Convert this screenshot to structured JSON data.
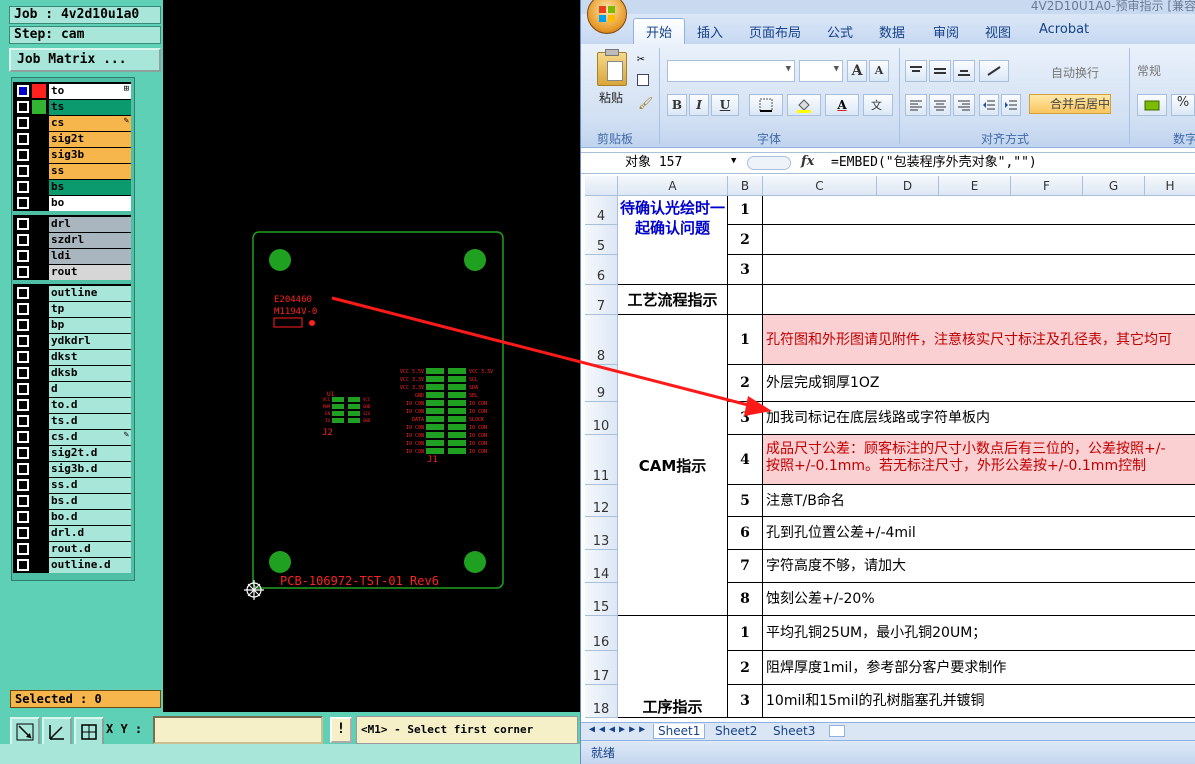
{
  "cam": {
    "job_label": "Job : 4v2d10u1a0",
    "step_label": "Step: cam",
    "job_matrix_button": "Job Matrix ...",
    "layers": [
      {
        "name": "to",
        "color": "#ffffff",
        "swatch": "#ff2020",
        "selected": true,
        "mark": "⊞"
      },
      {
        "name": "ts",
        "color": "#0a9a6e",
        "swatch": "#32b432",
        "selected": false,
        "mark": ""
      },
      {
        "name": "cs",
        "color": "#f6b64b",
        "swatch": "",
        "selected": false,
        "mark": "✎"
      },
      {
        "name": "sig2t",
        "color": "#f6b64b",
        "swatch": "",
        "selected": false,
        "mark": ""
      },
      {
        "name": "sig3b",
        "color": "#f6b64b",
        "swatch": "",
        "selected": false,
        "mark": ""
      },
      {
        "name": "ss",
        "color": "#f6b64b",
        "swatch": "",
        "selected": false,
        "mark": ""
      },
      {
        "name": "bs",
        "color": "#0a9a6e",
        "swatch": "",
        "selected": false,
        "mark": ""
      },
      {
        "name": "bo",
        "color": "#ffffff",
        "swatch": "",
        "selected": false,
        "mark": ""
      }
    ],
    "drill_layers": [
      {
        "name": "drl",
        "color": "#a9b6bf"
      },
      {
        "name": "szdrl",
        "color": "#a9b6bf"
      },
      {
        "name": "ldi",
        "color": "#a9b6bf"
      },
      {
        "name": "rout",
        "color": "#d6d6d6"
      }
    ],
    "misc_layers": [
      {
        "name": "outline",
        "mark": ""
      },
      {
        "name": "tp",
        "mark": ""
      },
      {
        "name": "bp",
        "mark": ""
      },
      {
        "name": "ydkdrl",
        "mark": ""
      },
      {
        "name": "dkst",
        "mark": ""
      },
      {
        "name": "dksb",
        "mark": ""
      },
      {
        "name": "d",
        "mark": ""
      },
      {
        "name": "to.d",
        "mark": ""
      },
      {
        "name": "ts.d",
        "mark": ""
      },
      {
        "name": "cs.d",
        "mark": "✎"
      },
      {
        "name": "sig2t.d",
        "mark": ""
      },
      {
        "name": "sig3b.d",
        "mark": ""
      },
      {
        "name": "ss.d",
        "mark": ""
      },
      {
        "name": "bs.d",
        "mark": ""
      },
      {
        "name": "bo.d",
        "mark": ""
      },
      {
        "name": "drl.d",
        "mark": ""
      },
      {
        "name": "rout.d",
        "mark": ""
      },
      {
        "name": "outline.d",
        "mark": ""
      }
    ],
    "misc_color": "#a9e6da",
    "selected_label": "Selected : 0",
    "xy_label": "X Y :",
    "xy_value": "",
    "bang_label": "!",
    "status_message": "<M1> - Select first corner",
    "board": {
      "part_code": "E204460",
      "ul_mark": "M1194V-0",
      "footer_text": "PCB-106972-TST-01   Rev6",
      "j1_label": "J1",
      "j2_label": "J2",
      "u1_label": "U1",
      "j1_left_pins": [
        "VCC 5.5V",
        "VCC 3.3V",
        "VCC 3.3V",
        "GND",
        "IO CON",
        "IO CON",
        "DATA",
        "IO CON",
        "IO CON",
        "IO CON",
        "IO CON"
      ],
      "j1_right_pins": [
        "VCC 3.3V",
        "SCL",
        "SDA",
        "SEL",
        "IO CON",
        "IO CON",
        "SLOCK",
        "IO CON",
        "IO CON",
        "IO CON",
        "IO CON"
      ],
      "j2_left_pins": [
        "VCC",
        "PWM",
        "EN",
        "IO"
      ],
      "j2_right_pins": [
        "VCC",
        "GND",
        "SIG",
        "GND"
      ]
    }
  },
  "excel": {
    "title": "4V2D10U1A0-预审指示 [兼容",
    "tabs": [
      "开始",
      "插入",
      "页面布局",
      "公式",
      "数据",
      "审阅",
      "视图",
      "Acrobat"
    ],
    "active_tab": "开始",
    "ribbon": {
      "paste_label": "粘贴",
      "clipboard_group": "剪贴板",
      "font_group": "字体",
      "align_group": "对齐方式",
      "number_group": "数字",
      "wrap_text": "自动换行",
      "merge_center": "合并后居中",
      "number_format": "常规",
      "bold": "B",
      "italic": "I",
      "underline": "U",
      "grow_font": "A",
      "shrink_font": "A",
      "font_color": "A",
      "percent": "%"
    },
    "name_box": "对象 157",
    "fx": "fx",
    "formula": "=EMBED(\"包装程序外壳对象\",\"\")",
    "columns": [
      "A",
      "B",
      "C",
      "D",
      "E",
      "F",
      "G",
      "H"
    ],
    "rows": [
      {
        "num": "4",
        "b": "1",
        "c": "",
        "pink": false
      },
      {
        "num": "5",
        "b": "2",
        "c": "",
        "pink": false
      },
      {
        "num": "6",
        "b": "3",
        "c": "",
        "pink": false
      },
      {
        "num": "7",
        "b": "",
        "c": "",
        "pink": false
      },
      {
        "num": "8",
        "b": "1",
        "c": "孔符图和外形图请见附件，注意核实尺寸标注及孔径表，其它均可",
        "pink": true
      },
      {
        "num": "9",
        "b": "2",
        "c": "外层完成铜厚1OZ",
        "pink": false
      },
      {
        "num": "10",
        "b": "3",
        "c": "加我司标记在底层线路或字符单板内",
        "pink": false
      },
      {
        "num": "11",
        "b": "4",
        "c": "成品尺寸公差：顾客标注的尺寸小数点后有三位的，公差按照+/-",
        "c2": "按照+/-0.1mm。若无标注尺寸，外形公差按+/-0.1mm控制",
        "pink": true
      },
      {
        "num": "12",
        "b": "5",
        "c": "注意T/B命名",
        "pink": false
      },
      {
        "num": "13",
        "b": "6",
        "c": "孔到孔位置公差+/-4mil",
        "pink": false
      },
      {
        "num": "14",
        "b": "7",
        "c": "字符高度不够，请加大",
        "pink": false
      },
      {
        "num": "15",
        "b": "8",
        "c": "蚀刻公差+/-20%",
        "pink": false
      },
      {
        "num": "16",
        "b": "1",
        "c": "平均孔铜25UM，最小孔铜20UM；",
        "pink": false
      },
      {
        "num": "17",
        "b": "2",
        "c": "阻焊厚度1mil，参考部分客户要求制作",
        "pink": false
      },
      {
        "num": "18",
        "b": "3",
        "c": "10mil和15mil的孔树脂塞孔并镀铜",
        "pink": false
      }
    ],
    "section_pending": "待确认光绘时一起确认问题",
    "section_process": "工艺流程指示",
    "section_cam": "CAM指示",
    "section_process_instr": "工序指示",
    "sheets": [
      "Sheet1",
      "Sheet2",
      "Sheet3"
    ],
    "status": "就绪"
  },
  "colors": {
    "cam_panel": "#5ed0b6",
    "board_green": "#20a020",
    "silk_red": "#ff2020",
    "pink_fill": "#fbd0d3",
    "pink_text": "#c00000",
    "header_blue": "#0000cc"
  }
}
